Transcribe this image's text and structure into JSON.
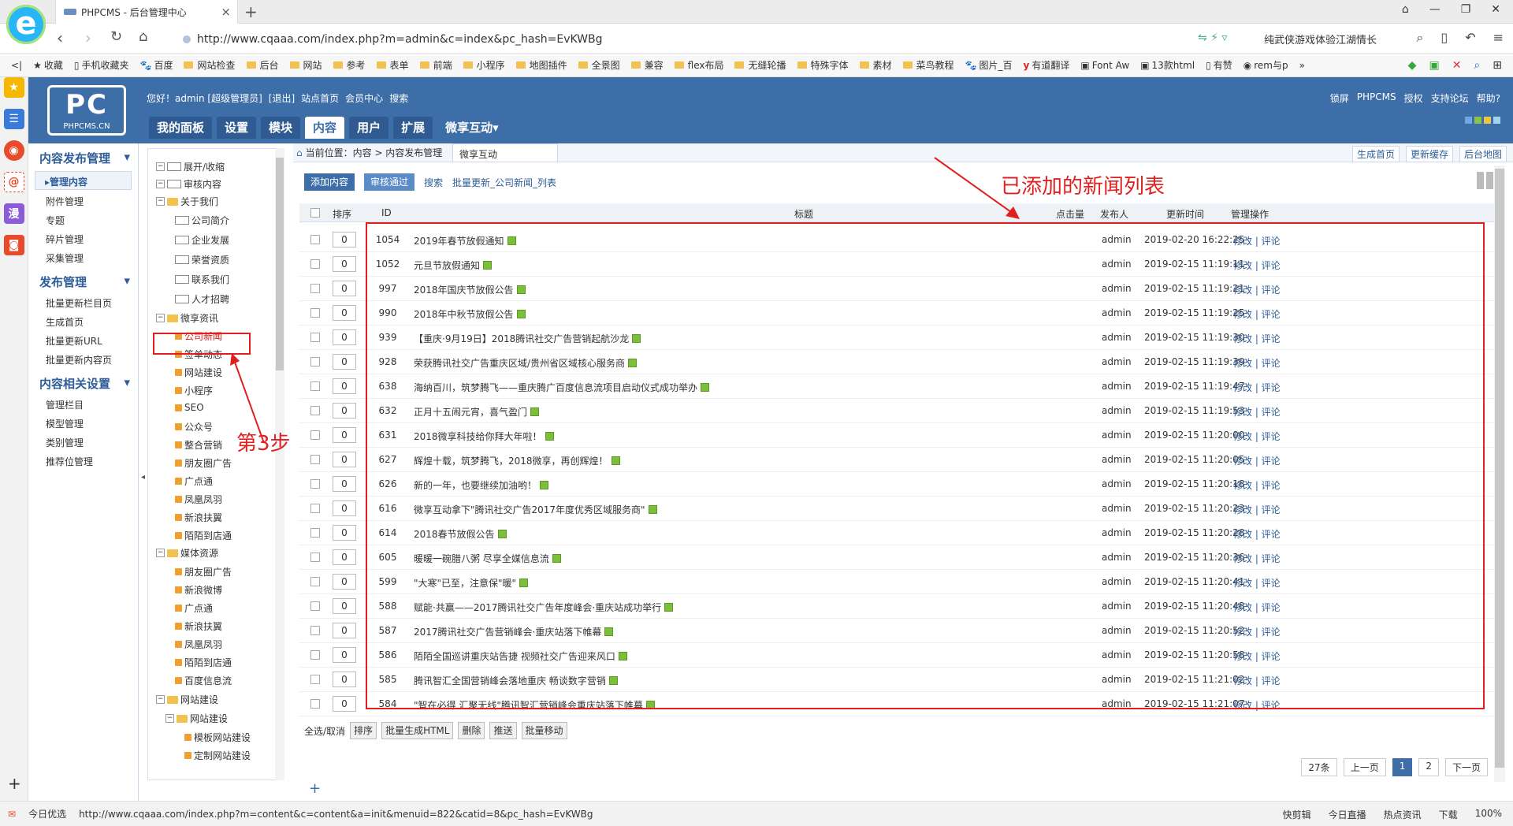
{
  "browser": {
    "tab_title": "PHPCMS - 后台管理中心",
    "url": "http://www.cqaaa.com/index.php?m=admin&c=index&pc_hash=EvKWBg",
    "search_text": "纯武侠游戏体验江湖情长",
    "bookmarks": [
      "收藏",
      "手机收藏夹",
      "百度",
      "网站检查",
      "后台",
      "网站",
      "参考",
      "表单",
      "前端",
      "小程序",
      "地图插件",
      "全景图",
      "兼容",
      "flex布局",
      "无缝轮播",
      "特殊字体",
      "素材",
      "菜鸟教程",
      "图片_百",
      "有道翻译",
      "Font Aw",
      "13款html",
      "有赞",
      "rem与p"
    ]
  },
  "header": {
    "logo_text": "PC",
    "logo_sub": "PHPCMS.CN",
    "greeting": "您好！admin [超级管理员]",
    "logout": "[退出]",
    "site_home": "站点首页",
    "member_center": "会员中心",
    "search": "搜索",
    "right_links": [
      "锁屏",
      "PHPCMS",
      "授权",
      "支持论坛",
      "帮助?"
    ],
    "nav": [
      "我的面板",
      "设置",
      "模块",
      "内容",
      "用户",
      "扩展",
      "微享互动▾"
    ],
    "active_nav": "内容"
  },
  "leftmenu": {
    "groups": [
      {
        "title": "内容发布管理",
        "items": [
          "管理内容",
          "附件管理",
          "专题",
          "碎片管理",
          "采集管理"
        ]
      },
      {
        "title": "发布管理",
        "items": [
          "批量更新栏目页",
          "生成首页",
          "批量更新URL",
          "批量更新内容页"
        ]
      },
      {
        "title": "内容相关设置",
        "items": [
          "管理栏目",
          "模型管理",
          "类别管理",
          "推荐位管理"
        ]
      }
    ],
    "active": "▸管理内容"
  },
  "tree": {
    "expand": "展开/收缩",
    "review": "审核内容",
    "about": "关于我们",
    "about_children": [
      "公司简介",
      "企业发展",
      "荣誉资质",
      "联系我们",
      "人才招聘"
    ],
    "news": "微享资讯",
    "news_children": [
      "公司新闻",
      "签单动态",
      "网站建设",
      "小程序",
      "SEO",
      "公众号",
      "整合营销",
      "朋友圈广告",
      "广点通",
      "凤凰凤羽",
      "新浪扶翼",
      "陌陌到店通"
    ],
    "media": "媒体资源",
    "media_children": [
      "朋友圈广告",
      "新浪微博",
      "广点通",
      "新浪扶翼",
      "凤凰凤羽",
      "陌陌到店通",
      "百度信息流"
    ],
    "web": "网站建设",
    "web_sub": "网站建设",
    "web_children": [
      "模板网站建设",
      "定制网站建设"
    ]
  },
  "content": {
    "crumb_label": "当前位置：内容 > 内容发布管理",
    "crumb_tip": "微享互动",
    "crumb_buttons": [
      "生成首页",
      "更新缓存",
      "后台地图"
    ],
    "toolbar": {
      "add": "添加内容",
      "approved": "审核通过",
      "search": "搜索",
      "batch": "批量更新_公司新闻_列表"
    },
    "columns": {
      "order": "排序",
      "id": "ID",
      "title": "标题",
      "hits": "点击量",
      "publisher": "发布人",
      "updated": "更新时间",
      "ops": "管理操作"
    },
    "rows": [
      {
        "order": "0",
        "id": "1054",
        "title": "2019年春节放假通知",
        "pub": "admin",
        "time": "2019-02-20 16:22:25"
      },
      {
        "order": "0",
        "id": "1052",
        "title": "元旦节放假通知",
        "pub": "admin",
        "time": "2019-02-15 11:19:11"
      },
      {
        "order": "0",
        "id": "997",
        "title": "2018年国庆节放假公告",
        "pub": "admin",
        "time": "2019-02-15 11:19:21"
      },
      {
        "order": "0",
        "id": "990",
        "title": "2018年中秋节放假公告",
        "pub": "admin",
        "time": "2019-02-15 11:19:25"
      },
      {
        "order": "0",
        "id": "939",
        "title": "【重庆·9月19日】2018腾讯社交广告营销起航沙龙",
        "pub": "admin",
        "time": "2019-02-15 11:19:30"
      },
      {
        "order": "0",
        "id": "928",
        "title": "荣获腾讯社交广告重庆区域/贵州省区域核心服务商",
        "pub": "admin",
        "time": "2019-02-15 11:19:39"
      },
      {
        "order": "0",
        "id": "638",
        "title": "海纳百川，筑梦腾飞——重庆腾广百度信息流项目启动仪式成功举办",
        "pub": "admin",
        "time": "2019-02-15 11:19:47"
      },
      {
        "order": "0",
        "id": "632",
        "title": "正月十五闹元宵，喜气盈门",
        "pub": "admin",
        "time": "2019-02-15 11:19:53"
      },
      {
        "order": "0",
        "id": "631",
        "title": "2018微享科技给你拜大年啦！",
        "pub": "admin",
        "time": "2019-02-15 11:20:00"
      },
      {
        "order": "0",
        "id": "627",
        "title": "辉煌十载，筑梦腾飞，2018微享，再创辉煌！",
        "pub": "admin",
        "time": "2019-02-15 11:20:05"
      },
      {
        "order": "0",
        "id": "626",
        "title": "新的一年，也要继续加油哟！",
        "pub": "admin",
        "time": "2019-02-15 11:20:18"
      },
      {
        "order": "0",
        "id": "616",
        "title": "微享互动拿下\"腾讯社交广告2017年度优秀区域服务商\"",
        "pub": "admin",
        "time": "2019-02-15 11:20:23"
      },
      {
        "order": "0",
        "id": "614",
        "title": "2018春节放假公告",
        "pub": "admin",
        "time": "2019-02-15 11:20:28"
      },
      {
        "order": "0",
        "id": "605",
        "title": "暖暖一碗腊八粥 尽享全媒信息流",
        "pub": "admin",
        "time": "2019-02-15 11:20:36"
      },
      {
        "order": "0",
        "id": "599",
        "title": "\"大寒\"已至，注意保\"暖\"",
        "pub": "admin",
        "time": "2019-02-15 11:20:41"
      },
      {
        "order": "0",
        "id": "588",
        "title": "赋能·共赢——2017腾讯社交广告年度峰会·重庆站成功举行",
        "pub": "admin",
        "time": "2019-02-15 11:20:48"
      },
      {
        "order": "0",
        "id": "587",
        "title": "2017腾讯社交广告营销峰会·重庆站落下帷幕",
        "pub": "admin",
        "time": "2019-02-15 11:20:52"
      },
      {
        "order": "0",
        "id": "586",
        "title": "陌陌全国巡讲重庆站告捷 视频社交广告迎来风口",
        "pub": "admin",
        "time": "2019-02-15 11:20:58"
      },
      {
        "order": "0",
        "id": "585",
        "title": "腾讯智汇全国营销峰会落地重庆 畅谈数字营销",
        "pub": "admin",
        "time": "2019-02-15 11:21:02"
      },
      {
        "order": "0",
        "id": "584",
        "title": "\"智在必得 汇聚无线\"腾讯智汇营销峰会重庆站落下帷幕",
        "pub": "admin",
        "time": "2019-02-15 11:21:07"
      }
    ],
    "op_edit": "修改 | 评论",
    "footer": {
      "select_all": "全选/取消",
      "buttons": [
        "排序",
        "批量生成HTML",
        "删除",
        "推送",
        "批量移动"
      ]
    },
    "pager": {
      "total": "27条",
      "prev": "上一页",
      "pages": [
        "1",
        "2"
      ],
      "current": "1",
      "next": "下一页"
    }
  },
  "annotations": {
    "list_label": "已添加的新闻列表",
    "step_label": "第3步"
  },
  "statusbar": {
    "left_label": "今日优选",
    "url": "http://www.cqaaa.com/index.php?m=content&c=content&a=init&menuid=822&catid=8&pc_hash=EvKWBg",
    "right": [
      "快剪辑",
      "今日直播",
      "热点资讯",
      "下载",
      "100%"
    ]
  },
  "colors": {
    "brand": "#3e6ea8",
    "annotation": "#e02020"
  }
}
